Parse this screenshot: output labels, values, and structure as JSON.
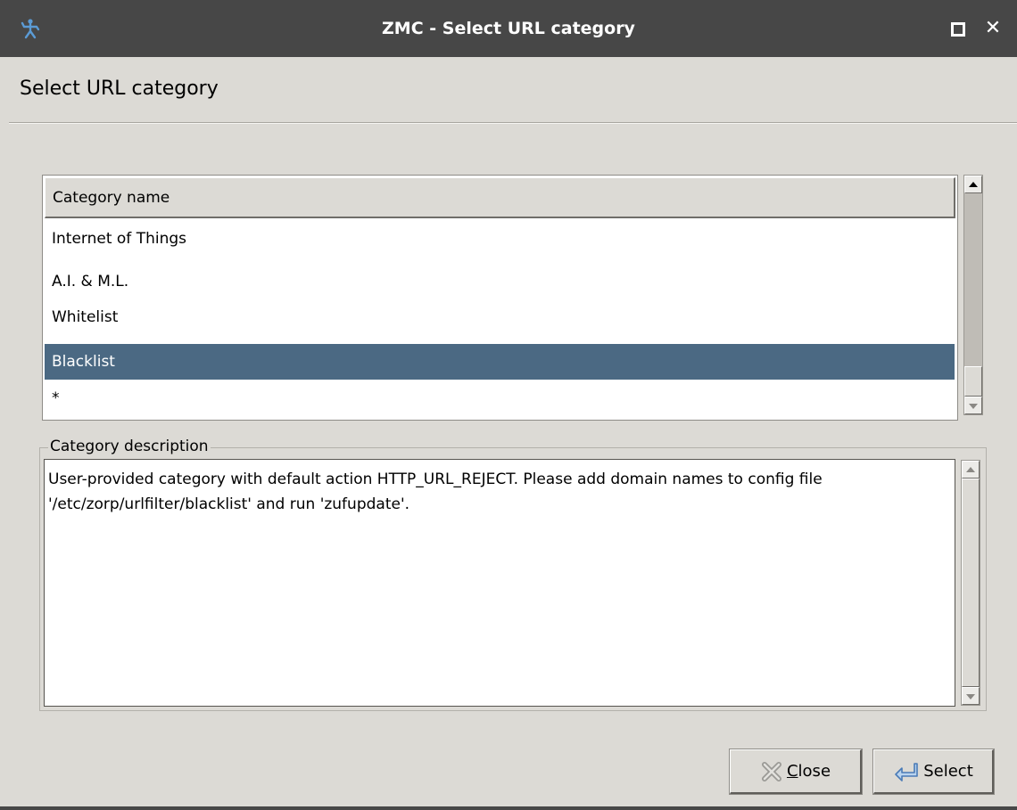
{
  "window": {
    "title": "ZMC - Select URL category",
    "icons": [
      "app-logo-icon",
      "maximize-icon",
      "close-icon"
    ],
    "close_glyph": "✕"
  },
  "header": {
    "title": "Select URL category"
  },
  "category_list": {
    "column_header": "Category name",
    "rows": [
      "Internet of Things",
      "A.I. & M.L.",
      "Whitelist",
      "Blacklist",
      "*"
    ],
    "selected_row": "Blacklist",
    "selection_color": "#4b6983"
  },
  "description": {
    "group_label": "Category description",
    "text": "User-provided category with default action HTTP_URL_REJECT. Please add domain names to config file\n'/etc/zorp/urlfilter/blacklist' and run 'zufupdate'."
  },
  "buttons": {
    "close": {
      "mnemonic": "C",
      "rest": "lose",
      "icon": "close-x-icon"
    },
    "select": {
      "label": "Select",
      "icon": "select-arrow-icon"
    }
  },
  "colors": {
    "titlebar": "#474747",
    "background": "#dcdad5",
    "accent": "#4b6983"
  }
}
